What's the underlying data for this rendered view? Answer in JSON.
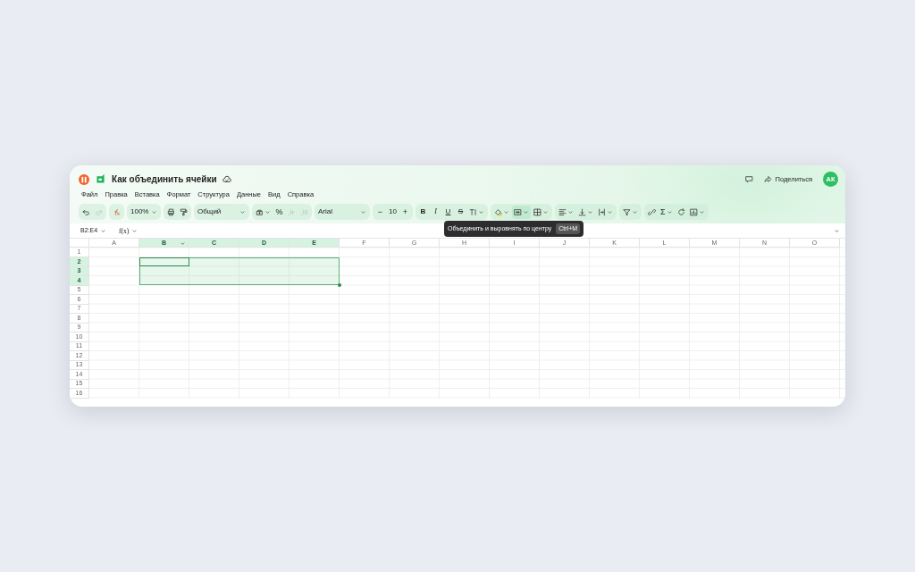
{
  "title": "Как объединить ячейки",
  "menu": [
    "Файл",
    "Правка",
    "Вставка",
    "Формат",
    "Структура",
    "Данные",
    "Вид",
    "Справка"
  ],
  "share_button": "Поделиться",
  "avatar": "АК",
  "toolbar": [
    {
      "items": [
        {
          "kind": "icon",
          "caret": false,
          "disabled": false,
          "highlighted": false
        },
        {
          "kind": "icon",
          "caret": false,
          "disabled": true,
          "highlighted": false
        }
      ]
    },
    {
      "items": [
        {
          "kind": "icon",
          "caret": false,
          "disabled": false,
          "highlighted": false
        }
      ]
    },
    {
      "items": [
        {
          "kind": "select",
          "value": "100%",
          "caret": true,
          "disabled": false,
          "highlighted": false
        }
      ]
    },
    {
      "items": [
        {
          "kind": "icon",
          "caret": false,
          "disabled": false,
          "highlighted": false
        },
        {
          "kind": "icon",
          "caret": false,
          "disabled": false,
          "highlighted": false
        }
      ]
    },
    {
      "items": [
        {
          "kind": "select",
          "value": "Общий",
          "caret": true,
          "disabled": false,
          "highlighted": false
        }
      ]
    },
    {
      "items": [
        {
          "kind": "icon",
          "caret": true,
          "disabled": false,
          "highlighted": false
        },
        {
          "kind": "symbol",
          "label": "%",
          "caret": false,
          "disabled": false,
          "highlighted": false
        },
        {
          "kind": "icon",
          "caret": false,
          "disabled": true,
          "highlighted": false
        },
        {
          "kind": "icon",
          "caret": false,
          "disabled": true,
          "highlighted": false
        }
      ]
    },
    {
      "items": [
        {
          "kind": "select",
          "value": "Arial",
          "caret": true,
          "disabled": false,
          "highlighted": false
        }
      ]
    },
    {
      "items": [
        {
          "kind": "symbol",
          "label": "−",
          "caret": false,
          "disabled": false,
          "highlighted": false
        },
        {
          "kind": "number",
          "label": "10",
          "caret": false,
          "disabled": false,
          "highlighted": false
        },
        {
          "kind": "symbol",
          "label": "+",
          "caret": false,
          "disabled": false,
          "highlighted": false
        }
      ]
    },
    {
      "items": [
        {
          "kind": "bold",
          "label": "B",
          "caret": false,
          "disabled": false,
          "highlighted": false
        },
        {
          "kind": "italic",
          "label": "I",
          "caret": false,
          "disabled": false,
          "highlighted": false
        },
        {
          "kind": "underline",
          "label": "U",
          "caret": false,
          "disabled": false,
          "highlighted": false
        },
        {
          "kind": "strike",
          "label": "S",
          "caret": false,
          "disabled": false,
          "highlighted": false
        },
        {
          "kind": "icon",
          "caret": true,
          "disabled": false,
          "highlighted": false
        }
      ]
    },
    {
      "items": [
        {
          "kind": "icon",
          "caret": true,
          "disabled": false,
          "highlighted": false
        },
        {
          "kind": "icon",
          "caret": true,
          "disabled": false,
          "highlighted": true
        },
        {
          "kind": "icon",
          "caret": true,
          "disabled": false,
          "highlighted": false
        }
      ]
    },
    {
      "items": [
        {
          "kind": "icon",
          "caret": true,
          "disabled": false,
          "highlighted": false
        },
        {
          "kind": "icon",
          "caret": true,
          "disabled": false,
          "highlighted": false
        },
        {
          "kind": "icon",
          "caret": true,
          "disabled": false,
          "highlighted": false
        }
      ]
    },
    {
      "items": [
        {
          "kind": "icon",
          "caret": true,
          "disabled": false,
          "highlighted": false
        }
      ]
    },
    {
      "items": [
        {
          "kind": "icon",
          "caret": false,
          "disabled": false,
          "highlighted": false
        },
        {
          "kind": "symbol",
          "label": "Σ",
          "caret": true,
          "disabled": false,
          "highlighted": false
        },
        {
          "kind": "icon",
          "caret": false,
          "disabled": false,
          "highlighted": false
        },
        {
          "kind": "icon",
          "caret": true,
          "disabled": false,
          "highlighted": false
        }
      ]
    }
  ],
  "tooltip": {
    "text": "Объединить и выровнять по центру",
    "shortcut": "Ctrl+M"
  },
  "formula_bar": {
    "name_box": "B2:E4",
    "function_label": "f(x)"
  },
  "grid": {
    "columns": [
      {
        "label": "A",
        "selected": false,
        "caret": false
      },
      {
        "label": "B",
        "selected": true,
        "caret": true
      },
      {
        "label": "C",
        "selected": true,
        "caret": false
      },
      {
        "label": "D",
        "selected": true,
        "caret": false
      },
      {
        "label": "E",
        "selected": true,
        "caret": false
      },
      {
        "label": "F",
        "selected": false,
        "caret": false
      },
      {
        "label": "G",
        "selected": false,
        "caret": false
      },
      {
        "label": "H",
        "selected": false,
        "caret": false
      },
      {
        "label": "I",
        "selected": false,
        "caret": false
      },
      {
        "label": "J",
        "selected": false,
        "caret": false
      },
      {
        "label": "K",
        "selected": false,
        "caret": false
      },
      {
        "label": "L",
        "selected": false,
        "caret": false
      },
      {
        "label": "M",
        "selected": false,
        "caret": false
      },
      {
        "label": "N",
        "selected": false,
        "caret": false
      },
      {
        "label": "O",
        "selected": false,
        "caret": false
      }
    ],
    "rows": [
      {
        "label": "1",
        "selected": false
      },
      {
        "label": "2",
        "selected": true
      },
      {
        "label": "3",
        "selected": true
      },
      {
        "label": "4",
        "selected": true
      },
      {
        "label": "5",
        "selected": false
      },
      {
        "label": "6",
        "selected": false
      },
      {
        "label": "7",
        "selected": false
      },
      {
        "label": "8",
        "selected": false
      },
      {
        "label": "9",
        "selected": false
      },
      {
        "label": "10",
        "selected": false
      },
      {
        "label": "11",
        "selected": false
      },
      {
        "label": "12",
        "selected": false
      },
      {
        "label": "13",
        "selected": false
      },
      {
        "label": "14",
        "selected": false
      },
      {
        "label": "15",
        "selected": false
      },
      {
        "label": "16",
        "selected": false
      }
    ]
  }
}
